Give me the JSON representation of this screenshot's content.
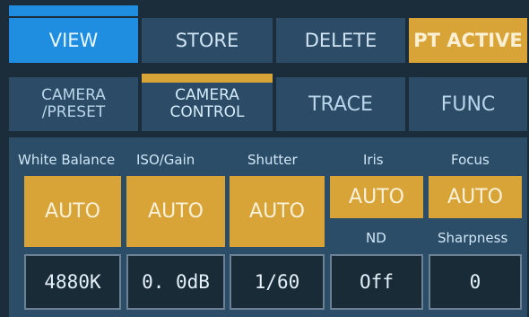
{
  "top_tabs": {
    "view": "VIEW",
    "store": "STORE",
    "delete": "DELETE",
    "pt_active": "PT ACTIVE"
  },
  "sub_tabs": {
    "camera_preset_line1": "CAMERA",
    "camera_preset_line2": "/PRESET",
    "camera_control_line1": "CAMERA",
    "camera_control_line2": "CONTROL",
    "trace": "TRACE",
    "func": "FUNC"
  },
  "controls": {
    "white_balance": {
      "label": "White Balance",
      "mode": "AUTO",
      "value": "4880K"
    },
    "iso_gain": {
      "label": "ISO/Gain",
      "mode": "AUTO",
      "value": "0. 0dB"
    },
    "shutter": {
      "label": "Shutter",
      "mode": "AUTO",
      "value": "1/60"
    },
    "iris": {
      "label": "Iris",
      "mode": "AUTO"
    },
    "focus": {
      "label": "Focus",
      "mode": "AUTO"
    },
    "nd": {
      "label": "ND",
      "value": "Off"
    },
    "sharpness": {
      "label": "Sharpness",
      "value": "0"
    }
  },
  "colors": {
    "accent_blue": "#1f8ee0",
    "accent_gold": "#d9a437",
    "tab_inactive": "#2b4b66",
    "background": "#1b2c3a"
  }
}
